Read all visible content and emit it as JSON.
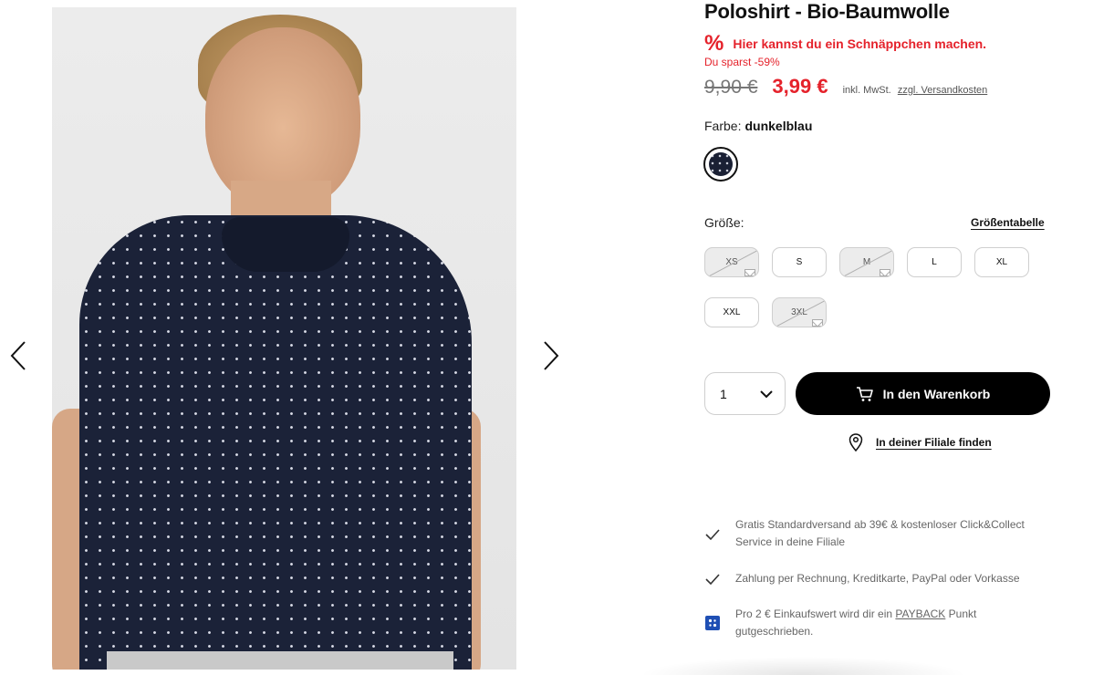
{
  "product": {
    "title": "Poloshirt - Bio-Baumwolle",
    "promo_icon": "%",
    "promo_text": "Hier kannst du ein Schnäppchen machen.",
    "savings": "Du sparst -59%",
    "old_price": "9,90 €",
    "new_price": "3,99 €",
    "vat_text": "inkl. MwSt.",
    "shipping_link": "zzgl. Versandkosten"
  },
  "color": {
    "label": "Farbe:",
    "value": "dunkelblau",
    "swatch_color": "#1a2034"
  },
  "size": {
    "label": "Größe:",
    "chart_link": "Größentabelle",
    "options": [
      {
        "label": "XS",
        "available": false
      },
      {
        "label": "S",
        "available": true
      },
      {
        "label": "M",
        "available": false
      },
      {
        "label": "L",
        "available": true
      },
      {
        "label": "XL",
        "available": true
      },
      {
        "label": "XXL",
        "available": true
      },
      {
        "label": "3XL",
        "available": false
      }
    ]
  },
  "purchase": {
    "quantity": "1",
    "cart_button": "In den Warenkorb",
    "store_link": "In deiner Filiale finden"
  },
  "benefits": {
    "shipping": "Gratis Standardversand ab 39€ & kostenloser Click&Collect Service in deine Filiale",
    "payment": "Zahlung per Rechnung, Kreditkarte, PayPal oder Vorkasse",
    "payback_pre": "Pro 2 € Einkaufswert wird dir ein ",
    "payback_link": "PAYBACK",
    "payback_post": " Punkt gutgeschrieben."
  },
  "colors": {
    "accent_red": "#e5222b",
    "button_black": "#000000",
    "payback_blue": "#1f4fb4"
  }
}
